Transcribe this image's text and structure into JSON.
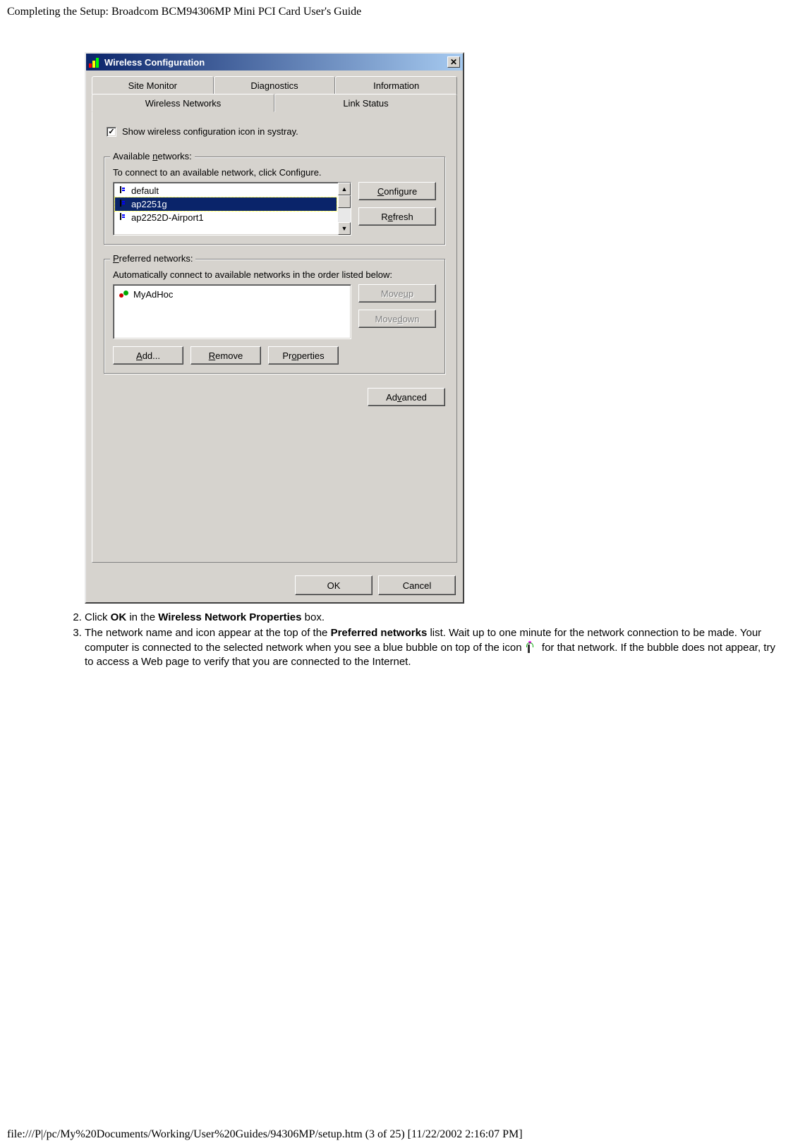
{
  "page": {
    "header": "Completing the Setup: Broadcom BCM94306MP Mini PCI Card User's Guide",
    "footer": "file:///P|/pc/My%20Documents/Working/User%20Guides/94306MP/setup.htm (3 of 25) [11/22/2002 2:16:07 PM]"
  },
  "dialog": {
    "title": "Wireless Configuration",
    "tabs_row1": {
      "t1": "Site Monitor",
      "t2": "Diagnostics",
      "t3": "Information"
    },
    "tabs_row2": {
      "t1": "Wireless Networks",
      "t2": "Link Status"
    },
    "systray_checkbox": "Show wireless configuration icon in systray.",
    "available": {
      "label_pre": "Available ",
      "label_u": "n",
      "label_post": "etworks:",
      "desc": "To connect to an available network, click Configure.",
      "items": [
        "default",
        "ap2251g",
        "ap2252D-Airport1"
      ],
      "configure_pre": "",
      "configure_u": "C",
      "configure_post": "onfigure",
      "refresh_pre": "R",
      "refresh_u": "e",
      "refresh_post": "fresh"
    },
    "preferred": {
      "label_pre": "",
      "label_u": "P",
      "label_post": "referred networks:",
      "desc": "Automatically connect to available networks in the order listed below:",
      "items": [
        "MyAdHoc"
      ],
      "moveup_pre": "Move ",
      "moveup_u": "u",
      "moveup_post": "p",
      "movedown_pre": "Move ",
      "movedown_u": "d",
      "movedown_post": "own",
      "add_pre": "",
      "add_u": "A",
      "add_post": "dd...",
      "remove_pre": "",
      "remove_u": "R",
      "remove_post": "emove",
      "props_pre": "Pr",
      "props_u": "o",
      "props_post": "perties"
    },
    "advanced_pre": "Ad",
    "advanced_u": "v",
    "advanced_post": "anced",
    "ok": "OK",
    "cancel": "Cancel"
  },
  "instructions": {
    "step2_pre": "Click ",
    "step2_b1": "OK",
    "step2_mid": " in the ",
    "step2_b2": "Wireless Network Properties",
    "step2_post": " box.",
    "step3_pre": "The network name and icon appear at the top of the ",
    "step3_b1": "Preferred networks",
    "step3_mid": " list. Wait up to one minute for the network connection to be made. Your computer is connected to the selected network when you see a blue bubble on top of the icon ",
    "step3_post": " for that network. If the bubble does not appear, try to access a Web page to verify that you are connected to the Internet."
  }
}
